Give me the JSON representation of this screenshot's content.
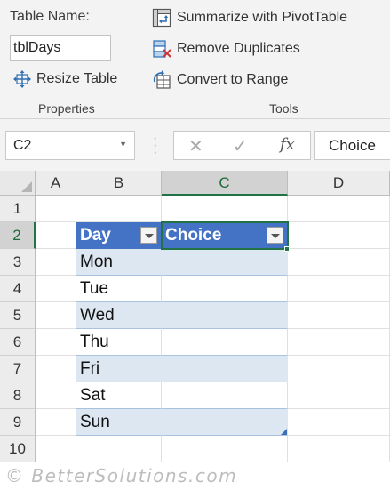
{
  "ribbon": {
    "table_name_label": "Table Name:",
    "table_name_value": "tblDays",
    "resize_table": "Resize Table",
    "properties_group": "Properties",
    "summarize_pivot": "Summarize with PivotTable",
    "remove_duplicates": "Remove Duplicates",
    "convert_to_range": "Convert to Range",
    "tools_group": "Tools"
  },
  "formula_bar": {
    "name_box": "C2",
    "fx": "fx",
    "content": "Choice"
  },
  "grid": {
    "columns": [
      "A",
      "B",
      "C",
      "D"
    ],
    "rows": [
      "1",
      "2",
      "3",
      "4",
      "5",
      "6",
      "7",
      "8",
      "9",
      "10"
    ],
    "active_cell": "C2",
    "table": {
      "headers": [
        "Day",
        "Choice"
      ],
      "days": [
        "Mon",
        "Tue",
        "Wed",
        "Thu",
        "Fri",
        "Sat",
        "Sun"
      ]
    }
  },
  "colors": {
    "header_fill": "#4472C4",
    "band_fill": "#DDE7F2",
    "accent_green": "#217346"
  },
  "footer": {
    "watermark": "© BetterSolutions.com"
  }
}
